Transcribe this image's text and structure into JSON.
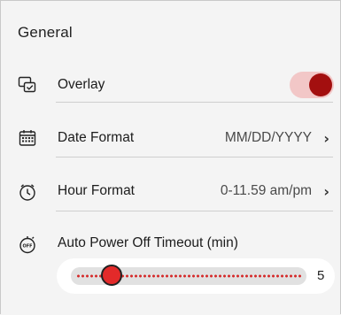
{
  "section": {
    "title": "General"
  },
  "rows": {
    "overlay": {
      "label": "Overlay",
      "icon": "overlay-icon",
      "enabled": true
    },
    "date_format": {
      "label": "Date Format",
      "value": "MM/DD/YYYY",
      "icon": "calendar-icon"
    },
    "hour_format": {
      "label": "Hour Format",
      "value": "0-11.59 am/pm",
      "icon": "clock-icon"
    },
    "auto_power_off": {
      "label": "Auto Power Off Timeout (min)",
      "icon": "timer-off-icon",
      "icon_text": "OFF",
      "value": "5",
      "slider_fraction": 0.14
    }
  },
  "colors": {
    "accent": "#a30f0f",
    "accent_light": "#f2c7c7",
    "slider_red": "#e32a2a"
  }
}
